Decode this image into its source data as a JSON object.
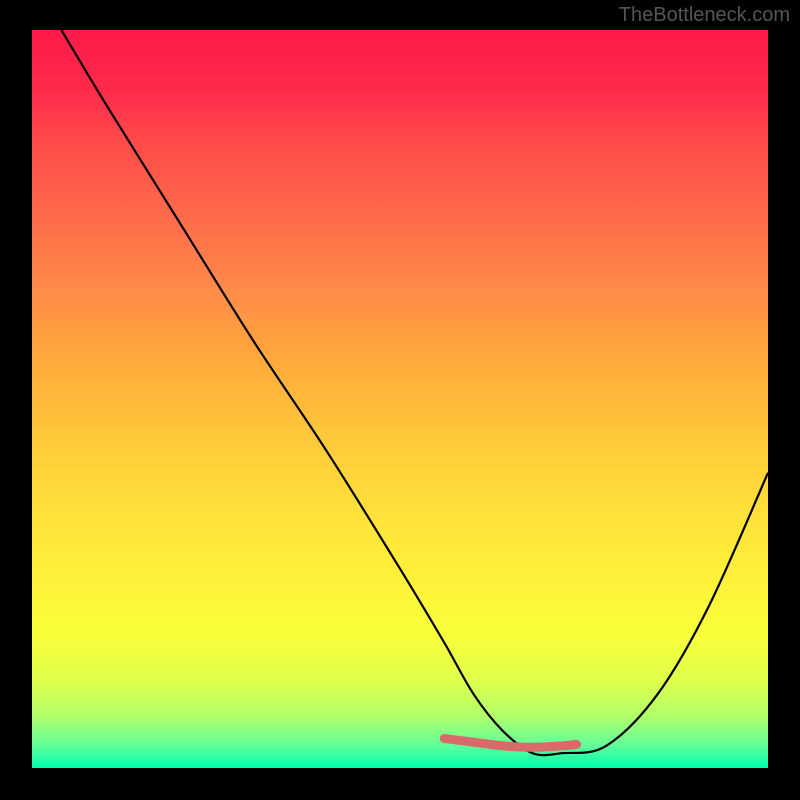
{
  "watermark": "TheBottleneck.com",
  "chart_data": {
    "type": "line",
    "title": "",
    "xlabel": "",
    "ylabel": "",
    "xlim": [
      0,
      100
    ],
    "ylim": [
      0,
      100
    ],
    "grid": false,
    "legend": false,
    "description": "Bottleneck-style V-curve over vertical rainbow gradient (red top to green bottom). Black curve descending steeply from upper left to a flat minimum, then rising to the right edge. Short red marker segment highlights the flat minimum.",
    "series": [
      {
        "name": "curve",
        "color": "#000000",
        "x": [
          4,
          10,
          20,
          30,
          40,
          50,
          56,
          60,
          64,
          68,
          72,
          78,
          85,
          92,
          100
        ],
        "y": [
          100,
          90,
          74,
          58,
          43,
          27,
          17,
          10,
          5,
          2,
          2,
          3,
          10,
          22,
          40
        ]
      },
      {
        "name": "highlight",
        "color": "#d96a6a",
        "x": [
          56,
          60,
          64,
          68,
          72,
          74
        ],
        "y": [
          4,
          3.5,
          3,
          2.8,
          3,
          3.2
        ]
      }
    ]
  }
}
